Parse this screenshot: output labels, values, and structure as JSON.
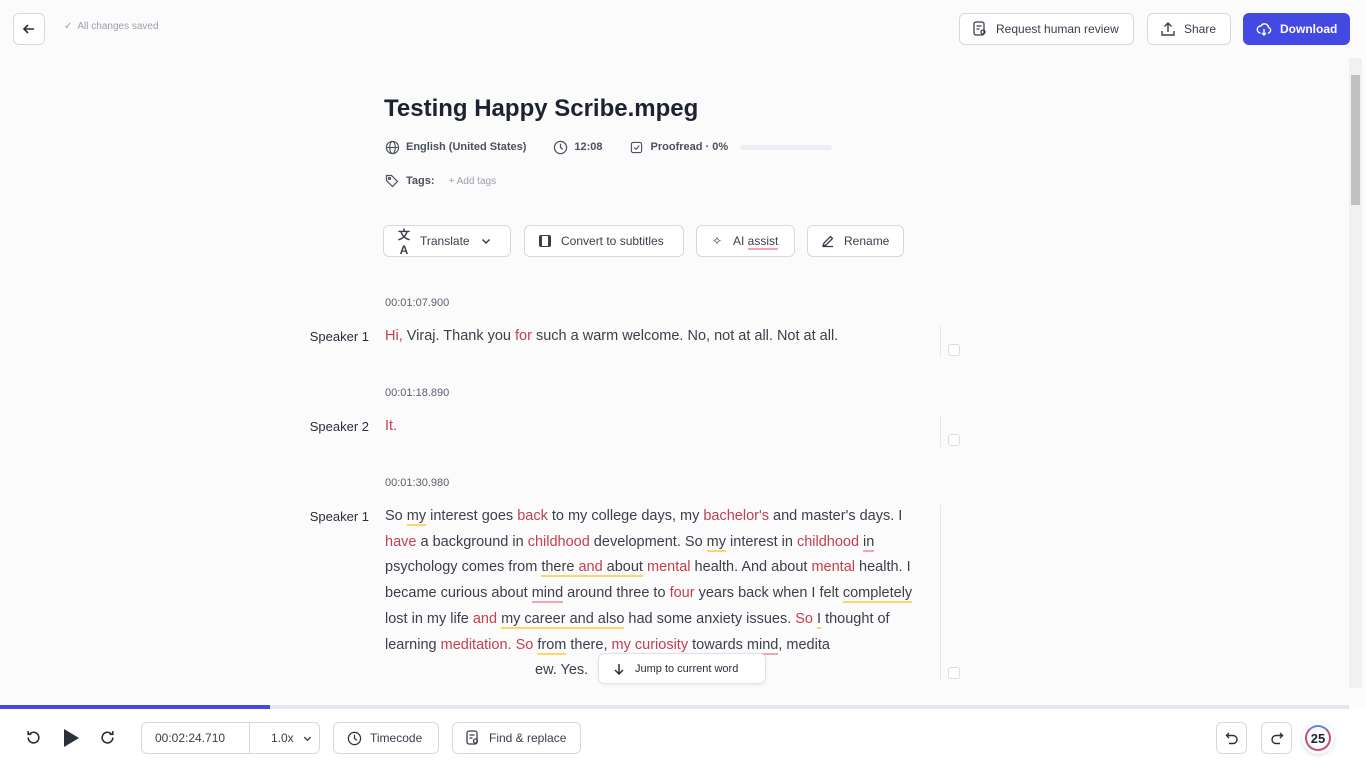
{
  "header": {
    "saved_status": "All changes saved",
    "request_review": "Request human review",
    "share": "Share",
    "download": "Download"
  },
  "file": {
    "title": "Testing Happy Scribe.mpeg",
    "language": "English (United States)",
    "duration": "12:08",
    "proofread": "Proofread · 0%",
    "proofread_percent": 0,
    "tags_label": "Tags:",
    "add_tags": "Add tags"
  },
  "toolbar": {
    "translate": "Translate",
    "convert": "Convert to subtitles",
    "ai_assist_prefix": "AI ",
    "ai_assist_word": "assist",
    "rename": "Rename"
  },
  "transcript": [
    {
      "timestamp": "00:01:07.900",
      "speaker": "Speaker 1",
      "segments": [
        [
          "Hi, ",
          "r"
        ],
        [
          "Viraj. Thank you ",
          ""
        ],
        [
          "for",
          "r"
        ],
        [
          " such a warm welcome. No, not at all. Not at all.",
          ""
        ]
      ]
    },
    {
      "timestamp": "00:01:18.890",
      "speaker": "Speaker 2",
      "segments": [
        [
          "It.",
          "r"
        ]
      ]
    },
    {
      "timestamp": "00:01:30.980",
      "speaker": "Speaker 1",
      "segments": [
        [
          "So ",
          ""
        ],
        [
          "my",
          "y"
        ],
        [
          " interest goes ",
          ""
        ],
        [
          "back",
          "r"
        ],
        [
          " to my college days, my ",
          ""
        ],
        [
          "bachelor's",
          "r"
        ],
        [
          " and master's days. I ",
          ""
        ],
        [
          "have",
          "r"
        ],
        [
          " a background in ",
          ""
        ],
        [
          "childhood",
          "r"
        ],
        [
          " development. So ",
          ""
        ],
        [
          "my",
          "y"
        ],
        [
          " interest in ",
          ""
        ],
        [
          "childhood",
          "r"
        ],
        [
          " ",
          ""
        ],
        [
          "in",
          "p"
        ],
        [
          " psychology comes from ",
          ""
        ],
        [
          "there ",
          "y"
        ],
        [
          "and",
          "ry"
        ],
        [
          " about",
          "y"
        ],
        [
          " ",
          ""
        ],
        [
          "mental",
          "r"
        ],
        [
          " health. And about ",
          ""
        ],
        [
          "mental",
          "r"
        ],
        [
          " health. I became curious about ",
          ""
        ],
        [
          "mind",
          "p"
        ],
        [
          " around three to ",
          ""
        ],
        [
          "four",
          "r"
        ],
        [
          " years back when I felt ",
          ""
        ],
        [
          "completely",
          "y"
        ],
        [
          " lost in my life ",
          ""
        ],
        [
          "and",
          "r"
        ],
        [
          " ",
          ""
        ],
        [
          "my career and also",
          "y"
        ],
        [
          " had some anxiety issues. ",
          ""
        ],
        [
          "So ",
          "r"
        ],
        [
          "I",
          "y"
        ],
        [
          " thought of learning ",
          ""
        ],
        [
          "meditation.",
          "r"
        ],
        [
          " ",
          ""
        ],
        [
          "So",
          "r"
        ],
        [
          " ",
          ""
        ],
        [
          "from",
          "y"
        ],
        [
          " there, ",
          ""
        ],
        [
          "my",
          "r"
        ],
        [
          " ",
          ""
        ],
        [
          "curiosity",
          "r"
        ],
        [
          " ",
          ""
        ],
        [
          "towards",
          "p"
        ],
        [
          " ",
          ""
        ],
        [
          "mind",
          "p"
        ],
        [
          ", medita",
          ""
        ],
        [
          "GAP",
          "gap"
        ],
        [
          "ew. Yes.",
          ""
        ]
      ]
    }
  ],
  "jump_button": "Jump to current word",
  "player": {
    "current_time": "00:02:24.710",
    "speed": "1.0x",
    "timecode": "Timecode",
    "find_replace": "Find & replace",
    "progress_percent": 20,
    "badge_count": "25"
  },
  "colors": {
    "accent": "#4449e4",
    "highlight_red": "#c2404f",
    "underline_yellow": "#fcd66b",
    "underline_pink": "#f4a3b3"
  }
}
